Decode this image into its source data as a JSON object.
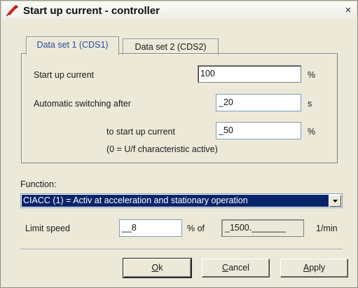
{
  "window": {
    "title": "Start up current - controller",
    "close_label": "×"
  },
  "tabs": [
    {
      "label": "Data set 1 (CDS1)",
      "active": true
    },
    {
      "label": "Data set 2 (CDS2)",
      "active": false
    }
  ],
  "data_set": {
    "start_up_current": {
      "label": "Start up current",
      "value": "100",
      "unit": "%"
    },
    "automatic_switching": {
      "label": "Automatic switching after",
      "value": "_20",
      "unit": "s"
    },
    "to_start_up_current": {
      "label": "to start up current",
      "value": "_50",
      "unit": "%"
    },
    "note": "(0 = U/f characteristic active)"
  },
  "function": {
    "label": "Function:",
    "selected": "CIACC (1) = Activ at acceleration and stationary operation"
  },
  "limit_speed": {
    "label": "Limit speed",
    "value": "__8",
    "percent_of": "% of",
    "reference": "_1500._______",
    "unit": "1/min"
  },
  "buttons": {
    "ok": {
      "mnemonic": "O",
      "rest": "k"
    },
    "cancel": {
      "mnemonic": "C",
      "rest": "ancel"
    },
    "apply": {
      "mnemonic": "A",
      "rest": "pply"
    }
  },
  "colors": {
    "dialog_bg": "#ece9d8",
    "selection_bg": "#0a246a",
    "active_tab_text": "#2a4a9c",
    "icon_red": "#d21f1f"
  },
  "icons": {
    "title": "plug-red-icon",
    "dropdown": "triangle-down-icon"
  }
}
